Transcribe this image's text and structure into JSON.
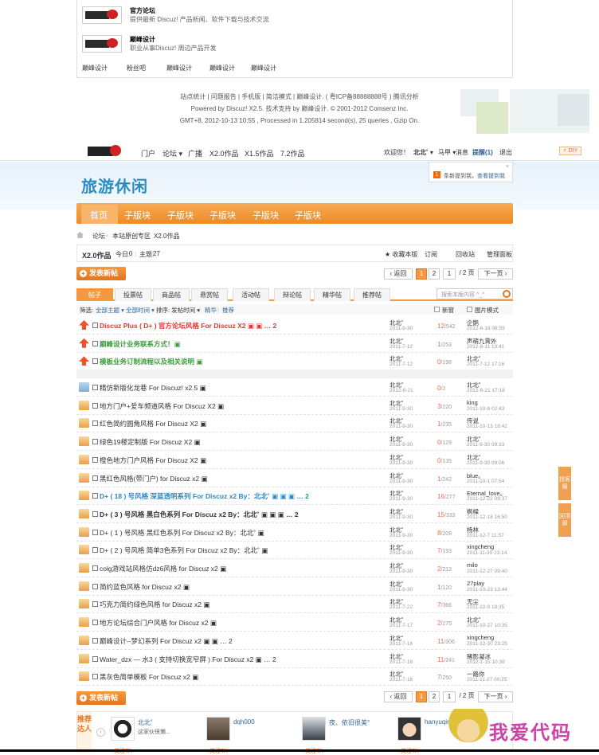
{
  "top": {
    "friends": [
      {
        "title": "官方论坛",
        "desc": "提供最新 Discuz! 产品新闻、软件下载与技术交流"
      },
      {
        "title": "巅峰设计",
        "desc": "职业从事Discuz! 周边产品开发"
      }
    ],
    "links": [
      "巅峰设计",
      "粉丝吧",
      "巅峰设计",
      "巅峰设计",
      "巅峰设计"
    ]
  },
  "footer": {
    "line1": "站点统计 | 问题报告 | 手机版 | 简洁模式 | 巅峰设计. ( 粤ICP备88888888号 ) 腾讯分析",
    "line2": "Powered by Discuz! X2.5. 技术支持 by 巅峰设计. © 2001-2012 Comsenz Inc.",
    "line3": "GMT+8, 2012-10-13 10:55 , Processed in 1.205814 second(s), 25 queries , Gzip On."
  },
  "header": {
    "nav": [
      "门户",
      "论坛 ▾",
      "广播",
      "X2.0作品",
      "X1.5作品",
      "7.2作品"
    ],
    "user": [
      "欢迎您！",
      "北北˚ ▾",
      "马甲 ▾",
      "消息",
      "提醒(1)",
      "退出"
    ],
    "diy": "⚡ DIY"
  },
  "banner": {
    "title": "旅游休闲",
    "notice_count": "1",
    "notice_text": "条新提到我，",
    "notice_link": "查看提到我",
    "notice_close": "×"
  },
  "subnav": [
    "首页",
    "子版块",
    "子版块",
    "子版块",
    "子版块",
    "子版块"
  ],
  "breadcrumb": [
    "论坛",
    "›",
    "本站原创专区",
    "›",
    "X2.0作品"
  ],
  "forum": {
    "name": "X2.0作品",
    "today_label": "今日:",
    "today": "0",
    "divider": "|",
    "topics_label": "主题:",
    "topics": "27",
    "actions": [
      "★ 收藏本版",
      "订阅",
      "回收站",
      "管理面板"
    ]
  },
  "post_button": "发表新帖",
  "post_plus": "+",
  "pager": {
    "prev": "‹ 返回",
    "pages": [
      "1",
      "2"
    ],
    "input": "1",
    "total": "/ 2 页",
    "next": "下一页 ›"
  },
  "tabs": [
    "帖子",
    "投票帖",
    "商品帖",
    "悬赏帖",
    "活动帖",
    "辩论帖",
    "精华帖",
    "推荐帖"
  ],
  "search_placeholder": "搜索本版内容 ^_^",
  "filter": {
    "items": [
      "筛选:",
      "全部主题 ▾",
      "全部时间 ▾",
      "排序: 发帖时间 ▾",
      "|",
      "精华",
      "|",
      "推荐"
    ],
    "new_label": "新窗",
    "pic_label": "图片模式"
  },
  "threads": [
    {
      "icon": "top",
      "style": "red",
      "title": "Discuz Plus ( D+ ) 官方论坛风格 For Discuz X2 ▣ ▣ … 2",
      "author": "北北˚",
      "date": "2011-9-30",
      "replies": "12",
      "views": "/542",
      "lastuser": "企鹅",
      "lastdate": "2012-6-18 08:59"
    },
    {
      "icon": "top",
      "style": "green",
      "title": "巅峰设计业务联系方式！▣",
      "author": "北北˚",
      "date": "2011-7-12",
      "replies": "1",
      "views": "/253",
      "lastuser": "声萌九霄外",
      "lastdate": "2012-8-11 13:41"
    },
    {
      "icon": "top",
      "style": "green",
      "title": "模板业务订制流程以及相关说明 ▣",
      "author": "北北˚",
      "date": "2011-7-12",
      "replies": "0",
      "views": "/198",
      "lastuser": "北北˚",
      "lastdate": "2011-7-12 17:16"
    },
    {
      "icon": "blue",
      "style": "",
      "title": "精仿新版化龙巷 For Discuz! x2.5 ▣",
      "author": "北北˚",
      "date": "2012-6-21",
      "replies": "0",
      "views": "/2",
      "lastuser": "北北˚",
      "lastdate": "2012-6-21 17:18"
    },
    {
      "icon": "norm",
      "style": "",
      "title": "地方门户+爱车频道风格 For Discuz X2 ▣",
      "author": "北北˚",
      "date": "2011-9-30",
      "replies": "3",
      "views": "/220",
      "lastuser": "king",
      "lastdate": "2011-10-9 02:43"
    },
    {
      "icon": "norm",
      "style": "",
      "title": "红色简约圆角风格 For Discuz X2 ▣",
      "author": "北北˚",
      "date": "2011-9-30",
      "replies": "1",
      "views": "/235",
      "lastuser": "传说",
      "lastdate": "2011-10-13 18:42"
    },
    {
      "icon": "norm",
      "style": "",
      "title": "绿色19楼定制版 For Discuz X2 ▣",
      "author": "北北˚",
      "date": "2011-9-30",
      "replies": "0",
      "views": "/129",
      "lastuser": "北北˚",
      "lastdate": "2011-9-30 09:33"
    },
    {
      "icon": "norm",
      "style": "",
      "title": "橙色地方门户风格 For Discuz X2 ▣",
      "author": "北北˚",
      "date": "2011-9-30",
      "replies": "0",
      "views": "/135",
      "lastuser": "北北˚",
      "lastdate": "2011-9-30 09:06"
    },
    {
      "icon": "norm",
      "style": "",
      "title": "黑红色风格(带门户) for Discuz x2 ▣",
      "author": "北北˚",
      "date": "2011-9-30",
      "replies": "1",
      "views": "/242",
      "lastuser": "blue。",
      "lastdate": "2011-10-1 07:54"
    },
    {
      "icon": "norm",
      "style": "blueb",
      "title": "D+ ( 18 ) 号风格 深蓝透明系列 For Discuz x2 By：北北˚ ▣ ▣ ▣ … 2",
      "author": "北北˚",
      "date": "2011-9-30",
      "replies": "16",
      "views": "/277",
      "lastuser": "Eternal_love。",
      "lastdate": "2011-12-22 09:37"
    },
    {
      "icon": "norm",
      "style": "bold",
      "title": "D+ ( 3 ) 号风格 黑白色系列 For Discuz x2 By：北北˚ ▣ ▣ ▣ … 2",
      "author": "北北˚",
      "date": "2011-9-30",
      "replies": "15",
      "views": "/333",
      "lastuser": "枫樑",
      "lastdate": "2011-12-18 16:50"
    },
    {
      "icon": "norm",
      "style": "",
      "title": "D+ ( 1 ) 号风格 黑红色系列 For Discuz x2 By：北北˚ ▣",
      "author": "北北˚",
      "date": "2011-9-30",
      "replies": "8",
      "views": "/209",
      "lastuser": "杨林",
      "lastdate": "2011-12-7 11:57"
    },
    {
      "icon": "norm",
      "style": "",
      "title": "D+ ( 2 ) 号风格 简单3色系列 For Discuz x2 By：北北˚ ▣",
      "author": "北北˚",
      "date": "2011-9-30",
      "replies": "7",
      "views": "/193",
      "lastuser": "xingcheng",
      "lastdate": "2011-11-30 23:14"
    },
    {
      "icon": "norm",
      "style": "",
      "title": "colg游戏站风格仿dz6风格 for Discuz x2 ▣",
      "author": "北北˚",
      "date": "2011-9-30",
      "replies": "2",
      "views": "/212",
      "lastuser": "milo",
      "lastdate": "2011-12-27 09:40"
    },
    {
      "icon": "norm",
      "style": "",
      "title": "简约蓝色风格 for Discuz x2 ▣",
      "author": "北北˚",
      "date": "2011-9-30",
      "replies": "1",
      "views": "/120",
      "lastuser": "27play",
      "lastdate": "2011-10-23 13:44"
    },
    {
      "icon": "norm",
      "style": "",
      "title": "巧克力简约绿色风格 for Discuz x2 ▣",
      "author": "北北˚",
      "date": "2011-7-22",
      "replies": "7",
      "views": "/366",
      "lastuser": "无尘",
      "lastdate": "2011-10-9 18:35"
    },
    {
      "icon": "norm",
      "style": "",
      "title": "地方论坛综合门户风格 for Discuz x2 ▣",
      "author": "北北˚",
      "date": "2011-7-17",
      "replies": "2",
      "views": "/275",
      "lastuser": "北北˚",
      "lastdate": "2011-10-27 10:35"
    },
    {
      "icon": "norm",
      "style": "",
      "title": "巅峰设计--梦幻系列 For Discuz x2 ▣ ▣ … 2",
      "author": "北北˚",
      "date": "2011-7-16",
      "replies": "11",
      "views": "/306",
      "lastuser": "xingcheng",
      "lastdate": "2011-12-30 23:25"
    },
    {
      "icon": "norm",
      "style": "",
      "title": "Water_dzx — 水3 ( 支持切换宽窄屏 ) For Discuz x2 ▣ … 2",
      "author": "北北˚",
      "date": "2011-7-16",
      "replies": "11",
      "views": "/241",
      "lastuser": "睹影凝冰",
      "lastdate": "2012-1-15 10:38"
    },
    {
      "icon": "norm",
      "style": "",
      "title": "黑灰色简单模板 For Discuz x2 ▣",
      "author": "北北˚",
      "date": "2011-7-16",
      "replies": "7",
      "views": "/250",
      "lastuser": "一路你",
      "lastdate": "2011-11-27 00:25"
    }
  ],
  "recommend": {
    "label": "推荐达人",
    "arrow": "‹",
    "users": [
      {
        "name": "北北˚",
        "sign": "这家伙很懒...",
        "follow": "+关注TA"
      },
      {
        "name": "dqh000",
        "sign": "",
        "follow": "+关注TA"
      },
      {
        "name": "夜、依旧很美°",
        "sign": "",
        "follow": "+关注TA"
      },
      {
        "name": "hanyuqing",
        "sign": "",
        "follow": "+关注TA"
      }
    ]
  },
  "side": [
    "找客服",
    "回顶部"
  ],
  "watermark": "我爱代码"
}
